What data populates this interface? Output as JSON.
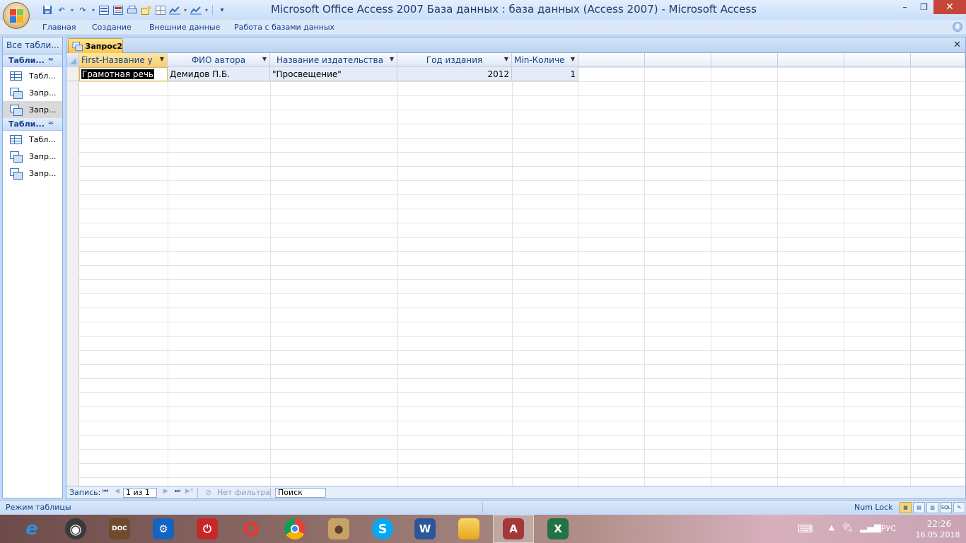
{
  "window": {
    "title": "Microsoft Office Access 2007 База данных : база данных (Access 2007)  -  Microsoft Access",
    "min_label": "–",
    "max_label": "❐",
    "close_label": "✕"
  },
  "quick_access": {
    "dropdown_glyph": "▾"
  },
  "ribbon": {
    "tabs": [
      "Главная",
      "Создание",
      "Внешние данные",
      "Работа с базами данных"
    ],
    "help_label": "?"
  },
  "nav": {
    "header": "Все табли...",
    "groups": [
      {
        "label": "Табли...",
        "chevron": "≈",
        "items": [
          {
            "label": "Табл...",
            "type": "table",
            "selected": false
          },
          {
            "label": "Запр...",
            "type": "query",
            "selected": false
          },
          {
            "label": "Запр...",
            "type": "query",
            "selected": true
          }
        ]
      },
      {
        "label": "Табли...",
        "chevron": "≈",
        "items": [
          {
            "label": "Табл...",
            "type": "table",
            "selected": false
          },
          {
            "label": "Запр...",
            "type": "query",
            "selected": false
          },
          {
            "label": "Запр...",
            "type": "query",
            "selected": false
          }
        ]
      }
    ]
  },
  "document": {
    "tab_label": "Запрос2",
    "close_label": "✕"
  },
  "datasheet": {
    "columns": [
      {
        "label": "First-Название у"
      },
      {
        "label": "ФИО автора"
      },
      {
        "label": "Название издательства"
      },
      {
        "label": "Год издания"
      },
      {
        "label": "Min-Количе"
      }
    ],
    "rows": [
      {
        "cells": [
          "Грамотная речь",
          "Демидов П.Б.",
          "\"Просвещение\"",
          "2012",
          "1"
        ]
      }
    ]
  },
  "record_nav": {
    "label": "Запись:",
    "first": "⏮",
    "prev": "◀",
    "position": "1 из 1",
    "next": "▶",
    "last": "⏭",
    "new": "▶*",
    "filter": "Нет фильтра",
    "search": "Поиск"
  },
  "status_bar": {
    "text": "Режим таблицы",
    "num_lock": "Num Lock",
    "view_sql": "SQL"
  },
  "taskbar": {
    "apps": [
      {
        "name": "internet-explorer",
        "glyph": "e",
        "color": "#1e88e5"
      },
      {
        "name": "speaker-app",
        "glyph": "◉",
        "color": "#444444"
      },
      {
        "name": "doc-viewer",
        "glyph": "DOC",
        "color": "#6d4c2f"
      },
      {
        "name": "settings-app",
        "glyph": "⚙",
        "color": "#1565c0"
      },
      {
        "name": "power-app",
        "glyph": "⏻",
        "color": "#c62828"
      },
      {
        "name": "opera",
        "glyph": "O",
        "color": "#e53935"
      },
      {
        "name": "chrome",
        "glyph": "◎",
        "color": "#43a047"
      },
      {
        "name": "media-app",
        "glyph": "●",
        "color": "#8d6e63"
      },
      {
        "name": "skype",
        "glyph": "S",
        "color": "#03a9f4"
      },
      {
        "name": "word",
        "glyph": "W",
        "color": "#2b579a"
      },
      {
        "name": "file-explorer",
        "glyph": "▭",
        "color": "#f9a825"
      },
      {
        "name": "access",
        "glyph": "A",
        "color": "#a4373a"
      },
      {
        "name": "excel",
        "glyph": "X",
        "color": "#217346"
      }
    ],
    "language": "РУС",
    "time": "22:26",
    "date": "16.05.2018"
  }
}
